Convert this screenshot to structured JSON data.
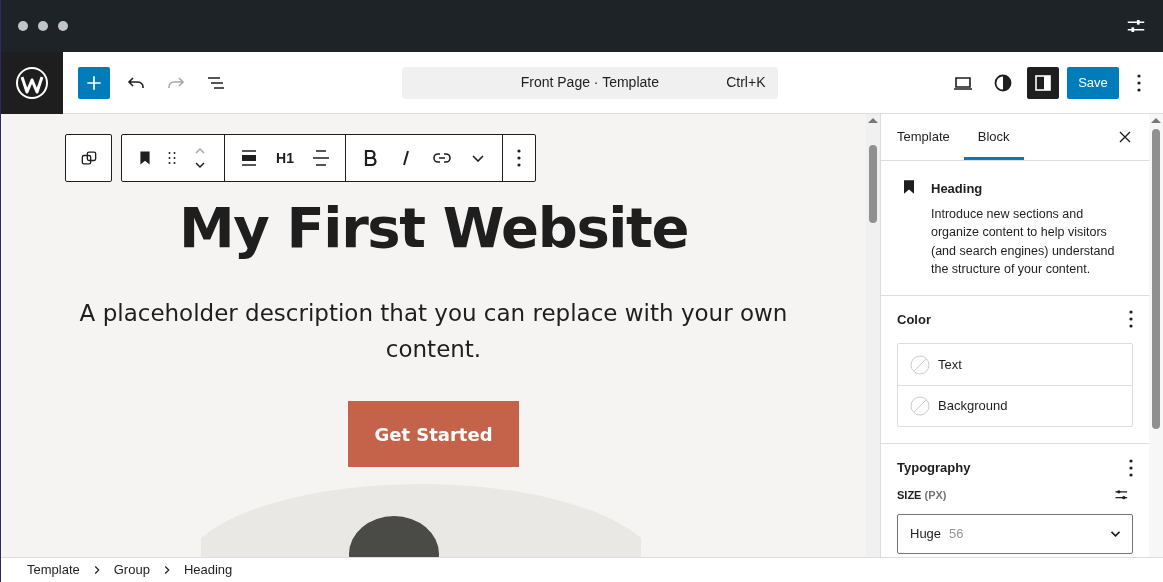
{
  "header": {
    "command_bar": {
      "title": "Front Page · Template",
      "shortcut": "Ctrl+K"
    },
    "sidebar_toggle": {
      "on": true
    },
    "save_label": "Save",
    "redo": {
      "disabled": true
    }
  },
  "block_toolbar": {
    "heading_level": "H1"
  },
  "canvas": {
    "heading": "My First Website",
    "description": "A placeholder description that you can replace with your own content.",
    "button": "Get Started"
  },
  "sidebar": {
    "tabs": [
      {
        "label": "Template",
        "selected": false
      },
      {
        "label": "Block",
        "selected": true
      }
    ],
    "block": {
      "title": "Heading",
      "description": "Introduce new sections and organize content to help visitors (and search engines) understand the structure of your content."
    },
    "color": {
      "title": "Color",
      "items": [
        {
          "label": "Text"
        },
        {
          "label": "Background"
        }
      ]
    },
    "typography": {
      "title": "Typography",
      "size_label": "SIZE",
      "size_unit": "(PX)",
      "size_value": "Huge",
      "size_hint": "56"
    }
  },
  "breadcrumbs": [
    "Template",
    "Group",
    "Heading"
  ]
}
